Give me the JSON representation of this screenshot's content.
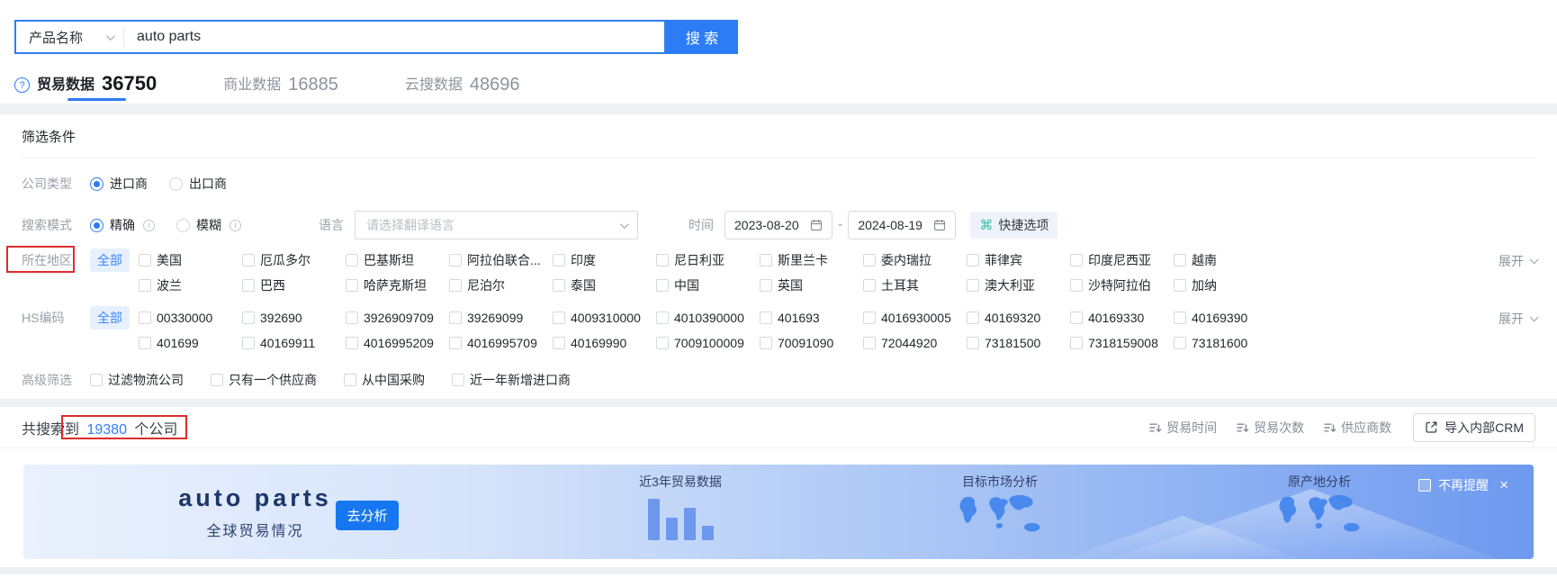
{
  "search": {
    "category": "产品名称",
    "query": "auto parts",
    "button": "搜 索"
  },
  "tabs": [
    {
      "label": "贸易数据",
      "count": "36750"
    },
    {
      "label": "商业数据",
      "count": "16885"
    },
    {
      "label": "云搜数据",
      "count": "48696"
    }
  ],
  "filters": {
    "title": "筛选条件",
    "company_type": {
      "label": "公司类型",
      "options": [
        "进口商",
        "出口商"
      ],
      "selected": "进口商"
    },
    "search_mode": {
      "label": "搜索模式",
      "options": [
        "精确",
        "模糊"
      ],
      "selected": "精确"
    },
    "language": {
      "label": "语言",
      "placeholder": "请选择翻译语言"
    },
    "time": {
      "label": "时间",
      "start": "2023-08-20",
      "separator": "-",
      "end": "2024-08-19"
    },
    "quick_option": "快捷选项",
    "region": {
      "label": "所在地区",
      "all": "全部",
      "expand": "展开",
      "items": [
        "美国",
        "厄瓜多尔",
        "巴基斯坦",
        "阿拉伯联合...",
        "印度",
        "尼日利亚",
        "斯里兰卡",
        "委内瑞拉",
        "菲律宾",
        "印度尼西亚",
        "越南",
        "波兰",
        "巴西",
        "哈萨克斯坦",
        "尼泊尔",
        "泰国",
        "中国",
        "英国",
        "土耳其",
        "澳大利亚",
        "沙特阿拉伯",
        "加纳"
      ]
    },
    "hs_code": {
      "label": "HS编码",
      "all": "全部",
      "expand": "展开",
      "items": [
        "00330000",
        "392690",
        "3926909709",
        "39269099",
        "4009310000",
        "4010390000",
        "401693",
        "4016930005",
        "40169320",
        "40169330",
        "40169390",
        "401699",
        "40169911",
        "4016995209",
        "4016995709",
        "40169990",
        "7009100009",
        "70091090",
        "72044920",
        "73181500",
        "7318159008",
        "73181600"
      ]
    },
    "advanced": {
      "label": "高级筛选",
      "items": [
        "过滤物流公司",
        "只有一个供应商",
        "从中国采购",
        "近一年新增进口商"
      ]
    }
  },
  "results": {
    "prefix": "共搜索到",
    "count": "19380",
    "suffix": "个公司",
    "sorts": [
      "贸易时间",
      "贸易次数",
      "供应商数"
    ],
    "crm_button": "导入内部CRM"
  },
  "banner": {
    "title": "auto parts",
    "subtitle": "全球贸易情况",
    "analyze_button": "去分析",
    "chart_label": "近3年贸易数据",
    "market_label": "目标市场分析",
    "origin_label": "原产地分析",
    "dismiss_label": "不再提醒",
    "bars": [
      46,
      25,
      36,
      16
    ]
  },
  "icons": {
    "command": "⌘",
    "close": "×"
  },
  "colors": {
    "primary": "#2b7cf5",
    "accent_teal": "#2fc3a7",
    "annotation_red": "#dd2c2c",
    "banner_navy": "#1c3668"
  }
}
